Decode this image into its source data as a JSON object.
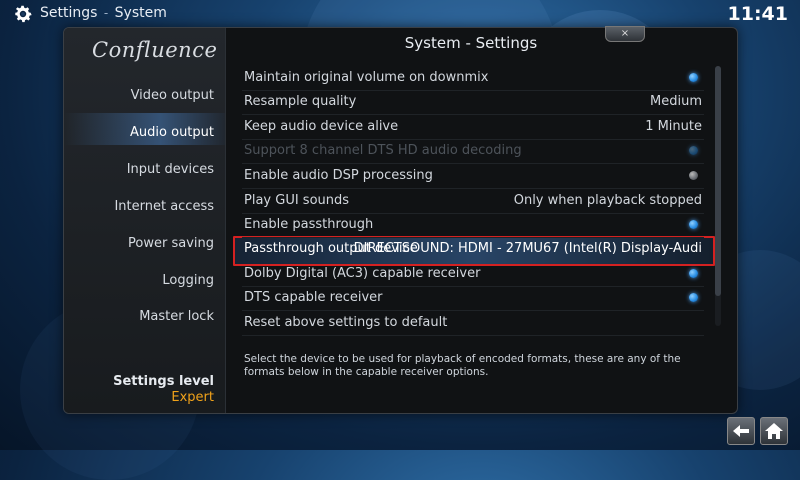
{
  "header": {
    "section": "Settings",
    "separator": "-",
    "page": "System",
    "clock": "11:41"
  },
  "sidebar": {
    "logo": "Confluence",
    "items": [
      {
        "label": "Video output"
      },
      {
        "label": "Audio output"
      },
      {
        "label": "Input devices"
      },
      {
        "label": "Internet access"
      },
      {
        "label": "Power saving"
      },
      {
        "label": "Logging"
      },
      {
        "label": "Master lock"
      }
    ],
    "active_index": 1,
    "settings_level_label": "Settings level",
    "settings_level_value": "Expert"
  },
  "content": {
    "title": "System - Settings",
    "close_label": "×",
    "rows": [
      {
        "label": "Maintain original volume on downmix",
        "type": "toggle",
        "on": true
      },
      {
        "label": "Resample quality",
        "type": "value",
        "value": "Medium"
      },
      {
        "label": "Keep audio device alive",
        "type": "value",
        "value": "1 Minute"
      },
      {
        "label": "Support 8 channel DTS HD audio decoding",
        "type": "toggle",
        "on": true,
        "disabled": true
      },
      {
        "label": "Enable audio DSP processing",
        "type": "toggle",
        "on": false
      },
      {
        "label": "Play GUI sounds",
        "type": "value",
        "value": "Only when playback stopped"
      },
      {
        "label": "Enable passthrough",
        "type": "toggle",
        "on": true
      },
      {
        "label": "Passthrough output device",
        "type": "value",
        "value": "DIRECTSOUND: HDMI - 27MU67 (Intel(R) Display-Audi",
        "focused": true
      },
      {
        "label": "Dolby Digital (AC3) capable receiver",
        "type": "toggle",
        "on": true
      },
      {
        "label": "DTS capable receiver",
        "type": "toggle",
        "on": true
      },
      {
        "label": "Reset above settings to default",
        "type": "action"
      }
    ],
    "help_text": "Select the device to be used for playback of encoded formats, these are any of the formats below in the capable receiver options."
  },
  "footer": {
    "back_icon": "back-arrow-icon",
    "home_icon": "home-icon"
  },
  "colors": {
    "accent": "#f0a21a",
    "focus_border": "#d42121",
    "radio_on": "#2a8fe6"
  }
}
